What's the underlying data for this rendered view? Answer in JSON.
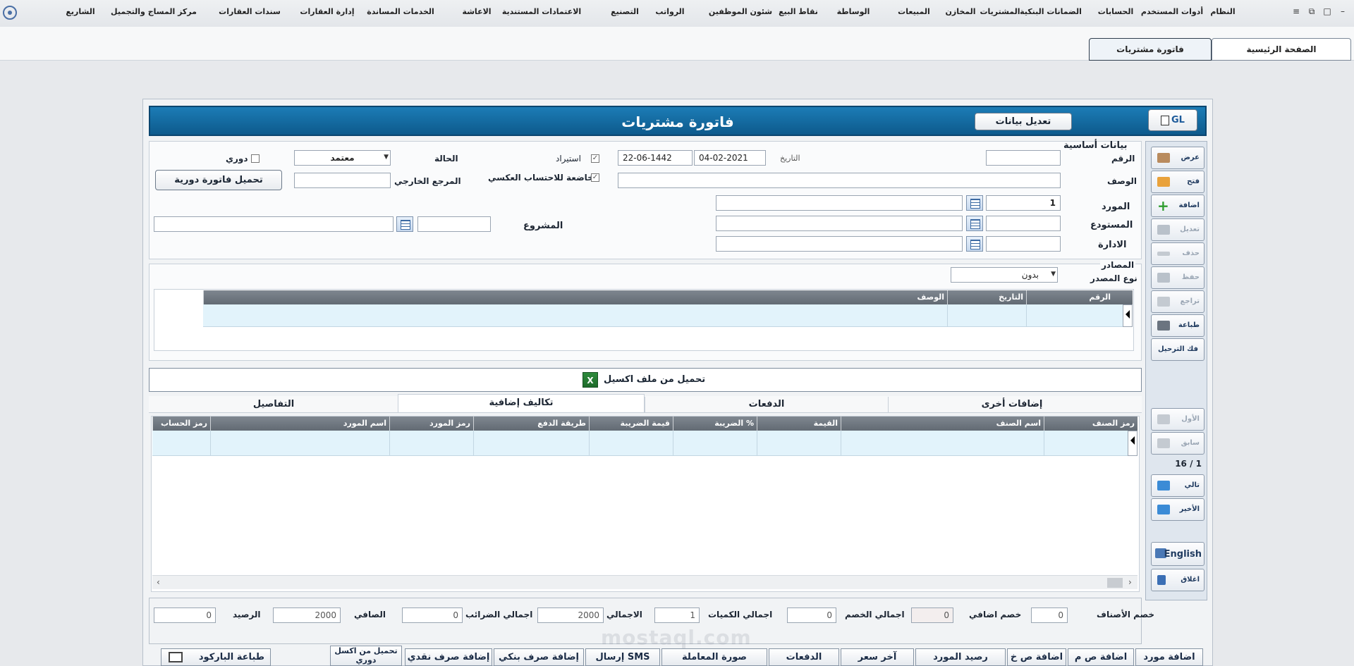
{
  "menu": {
    "items": [
      "النظام",
      "أدوات المستخدم",
      "الحسابات",
      "الضمانات البنكية",
      "المشتريات",
      "المخازن",
      "المبيعات",
      "الوساطة",
      "نقاط البيع",
      "شئون الموظفين",
      "الرواتب",
      "التصنيع",
      "الاعتمادات المستندية",
      "الاعاشة",
      "الخدمات المساندة",
      "إدارة العقارات",
      "سندات العقارات",
      "مركز المساج والتجميل",
      "الشاريع"
    ]
  },
  "window_controls": {
    "restore": "⧉",
    "maximize": "□",
    "minimize": "–",
    "menu": "≡"
  },
  "tabs": [
    {
      "label": "الصفحة الرئيسية"
    },
    {
      "label": "فاتورة مشتريات"
    }
  ],
  "title": "فاتورة مشتريات",
  "edit_data_button": "تعديل بيانات",
  "gl_button": "GL",
  "side_toolbar": {
    "view": "عرض",
    "open": "فتح",
    "add": "اضافة",
    "edit": "تعديل",
    "delete": "حذف",
    "save": "حفظ",
    "undo": "تراجع",
    "print": "طباعة",
    "unpost": "فك الترحيل",
    "first": "الأول",
    "prev": "سابق",
    "record_counter": "16 / 1",
    "next": "تالي",
    "last": "الأخير",
    "english": "English",
    "close": "اغلاق"
  },
  "basic": {
    "section_title": "بيانات أساسية",
    "number_label": "الرقم",
    "number_value": "",
    "date_label": "التاريخ",
    "date_greg": "04-02-2021",
    "date_hijri": "22-06-1442",
    "import_label": "استيراد",
    "reverse_calc_label": "خاضعة للاحتساب العكسي",
    "status_label": "الحالة",
    "status_value": "معتمد",
    "periodic_label": "دوري",
    "description_label": "الوصف",
    "external_ref_label": "المرجع الخارجي",
    "load_periodic_button": "تحميل فاتورة دورية",
    "supplier_label": "المورد",
    "supplier_code": "1",
    "warehouse_label": "المستودع",
    "department_label": "الادارة",
    "project_label": "المشروع"
  },
  "sources": {
    "title": "المصادر",
    "type_label": "نوع المصدر",
    "type_value": "بدون",
    "columns": [
      "الرقم",
      "التاريخ",
      "الوصف"
    ]
  },
  "excel_button": "تحميل من ملف اكسيل",
  "subtabs": [
    "إضافات أخرى",
    "الدفعات",
    "تكاليف إضافية",
    "التفاصيل"
  ],
  "items_grid": {
    "columns": [
      "رمز الصنف",
      "اسم الصنف",
      "القيمة",
      "الضريبة %",
      "قيمة الضريبة",
      "طريقة الدفع",
      "رمز المورد",
      "اسم المورد",
      "رمز الحساب"
    ]
  },
  "totals": {
    "items_discount_label": "خصم الأصناف",
    "items_discount": "0",
    "extra_discount_label": "خصم اضافي",
    "extra_discount": "0",
    "total_discount_label": "اجمالي الخصم",
    "total_discount": "0",
    "total_qty_label": "اجمالي الكميات",
    "total_qty": "1",
    "gross_label": "الاجمالي",
    "gross": "2000",
    "total_tax_label": "اجمالي الضرائب",
    "total_tax": "0",
    "net_label": "الصافي",
    "net": "2000",
    "balance_label": "الرصيد",
    "balance": "0"
  },
  "bottom_buttons": [
    "اضافة مورد",
    "اضافة ص م",
    "اضافة ص خ",
    "رصيد المورد",
    "آخر سعر",
    "الدفعات",
    "صورة المعاملة",
    "إرسال SMS",
    "إضافة صرف بنكي",
    "إضافة صرف نقدي",
    "تحميل من اكسل دوري",
    "طباعة الباركود"
  ],
  "watermark": "mostaql.com"
}
